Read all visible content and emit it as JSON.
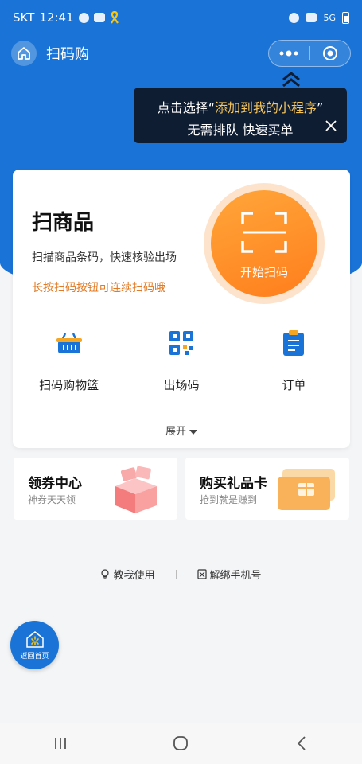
{
  "status_bar": {
    "carrier": "SKT",
    "time": "12:41",
    "network": "5G"
  },
  "nav": {
    "title": "扫码购",
    "home_icon": "home-icon",
    "more_icon": "more-icon",
    "close_icon": "target-icon"
  },
  "tooltip": {
    "prefix": "点击选择",
    "quote_open": "“",
    "highlight": "添加到我的小程序",
    "quote_close": "”",
    "line2": "无需排队 快速买单"
  },
  "scan_card": {
    "title": "扫商品",
    "description": "扫描商品条码，快速核验出场",
    "tip": "长按扫码按钮可连续扫码哦",
    "scan_button_label": "开始扫码"
  },
  "functions": [
    {
      "label": "扫码购物篮",
      "icon": "basket-icon"
    },
    {
      "label": "出场码",
      "icon": "qr-code-icon"
    },
    {
      "label": "订单",
      "icon": "clipboard-icon"
    }
  ],
  "expand_label": "展开",
  "promos": [
    {
      "title": "领券中心",
      "subtitle": "神券天天领"
    },
    {
      "title": "购买礼品卡",
      "subtitle": "抢到就是赚到"
    }
  ],
  "links": [
    {
      "label": "教我使用",
      "icon": "lightbulb-icon"
    },
    {
      "label": "解绑手机号",
      "icon": "phone-unbind-icon"
    }
  ],
  "float_home": {
    "label": "返回首页"
  },
  "colors": {
    "primary": "#1a73d6",
    "accent_orange": "#ff8a26",
    "tip_orange": "#e07a24",
    "tooltip_highlight": "#f5c55a"
  }
}
